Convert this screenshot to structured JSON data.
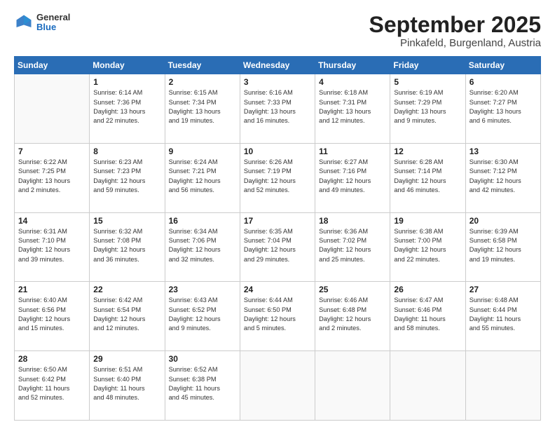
{
  "header": {
    "logo": {
      "general": "General",
      "blue": "Blue"
    },
    "title": "September 2025",
    "subtitle": "Pinkafeld, Burgenland, Austria"
  },
  "calendar": {
    "headers": [
      "Sunday",
      "Monday",
      "Tuesday",
      "Wednesday",
      "Thursday",
      "Friday",
      "Saturday"
    ],
    "weeks": [
      [
        {
          "day": "",
          "info": ""
        },
        {
          "day": "1",
          "info": "Sunrise: 6:14 AM\nSunset: 7:36 PM\nDaylight: 13 hours\nand 22 minutes."
        },
        {
          "day": "2",
          "info": "Sunrise: 6:15 AM\nSunset: 7:34 PM\nDaylight: 13 hours\nand 19 minutes."
        },
        {
          "day": "3",
          "info": "Sunrise: 6:16 AM\nSunset: 7:33 PM\nDaylight: 13 hours\nand 16 minutes."
        },
        {
          "day": "4",
          "info": "Sunrise: 6:18 AM\nSunset: 7:31 PM\nDaylight: 13 hours\nand 12 minutes."
        },
        {
          "day": "5",
          "info": "Sunrise: 6:19 AM\nSunset: 7:29 PM\nDaylight: 13 hours\nand 9 minutes."
        },
        {
          "day": "6",
          "info": "Sunrise: 6:20 AM\nSunset: 7:27 PM\nDaylight: 13 hours\nand 6 minutes."
        }
      ],
      [
        {
          "day": "7",
          "info": "Sunrise: 6:22 AM\nSunset: 7:25 PM\nDaylight: 13 hours\nand 2 minutes."
        },
        {
          "day": "8",
          "info": "Sunrise: 6:23 AM\nSunset: 7:23 PM\nDaylight: 12 hours\nand 59 minutes."
        },
        {
          "day": "9",
          "info": "Sunrise: 6:24 AM\nSunset: 7:21 PM\nDaylight: 12 hours\nand 56 minutes."
        },
        {
          "day": "10",
          "info": "Sunrise: 6:26 AM\nSunset: 7:19 PM\nDaylight: 12 hours\nand 52 minutes."
        },
        {
          "day": "11",
          "info": "Sunrise: 6:27 AM\nSunset: 7:16 PM\nDaylight: 12 hours\nand 49 minutes."
        },
        {
          "day": "12",
          "info": "Sunrise: 6:28 AM\nSunset: 7:14 PM\nDaylight: 12 hours\nand 46 minutes."
        },
        {
          "day": "13",
          "info": "Sunrise: 6:30 AM\nSunset: 7:12 PM\nDaylight: 12 hours\nand 42 minutes."
        }
      ],
      [
        {
          "day": "14",
          "info": "Sunrise: 6:31 AM\nSunset: 7:10 PM\nDaylight: 12 hours\nand 39 minutes."
        },
        {
          "day": "15",
          "info": "Sunrise: 6:32 AM\nSunset: 7:08 PM\nDaylight: 12 hours\nand 36 minutes."
        },
        {
          "day": "16",
          "info": "Sunrise: 6:34 AM\nSunset: 7:06 PM\nDaylight: 12 hours\nand 32 minutes."
        },
        {
          "day": "17",
          "info": "Sunrise: 6:35 AM\nSunset: 7:04 PM\nDaylight: 12 hours\nand 29 minutes."
        },
        {
          "day": "18",
          "info": "Sunrise: 6:36 AM\nSunset: 7:02 PM\nDaylight: 12 hours\nand 25 minutes."
        },
        {
          "day": "19",
          "info": "Sunrise: 6:38 AM\nSunset: 7:00 PM\nDaylight: 12 hours\nand 22 minutes."
        },
        {
          "day": "20",
          "info": "Sunrise: 6:39 AM\nSunset: 6:58 PM\nDaylight: 12 hours\nand 19 minutes."
        }
      ],
      [
        {
          "day": "21",
          "info": "Sunrise: 6:40 AM\nSunset: 6:56 PM\nDaylight: 12 hours\nand 15 minutes."
        },
        {
          "day": "22",
          "info": "Sunrise: 6:42 AM\nSunset: 6:54 PM\nDaylight: 12 hours\nand 12 minutes."
        },
        {
          "day": "23",
          "info": "Sunrise: 6:43 AM\nSunset: 6:52 PM\nDaylight: 12 hours\nand 9 minutes."
        },
        {
          "day": "24",
          "info": "Sunrise: 6:44 AM\nSunset: 6:50 PM\nDaylight: 12 hours\nand 5 minutes."
        },
        {
          "day": "25",
          "info": "Sunrise: 6:46 AM\nSunset: 6:48 PM\nDaylight: 12 hours\nand 2 minutes."
        },
        {
          "day": "26",
          "info": "Sunrise: 6:47 AM\nSunset: 6:46 PM\nDaylight: 11 hours\nand 58 minutes."
        },
        {
          "day": "27",
          "info": "Sunrise: 6:48 AM\nSunset: 6:44 PM\nDaylight: 11 hours\nand 55 minutes."
        }
      ],
      [
        {
          "day": "28",
          "info": "Sunrise: 6:50 AM\nSunset: 6:42 PM\nDaylight: 11 hours\nand 52 minutes."
        },
        {
          "day": "29",
          "info": "Sunrise: 6:51 AM\nSunset: 6:40 PM\nDaylight: 11 hours\nand 48 minutes."
        },
        {
          "day": "30",
          "info": "Sunrise: 6:52 AM\nSunset: 6:38 PM\nDaylight: 11 hours\nand 45 minutes."
        },
        {
          "day": "",
          "info": ""
        },
        {
          "day": "",
          "info": ""
        },
        {
          "day": "",
          "info": ""
        },
        {
          "day": "",
          "info": ""
        }
      ]
    ]
  }
}
